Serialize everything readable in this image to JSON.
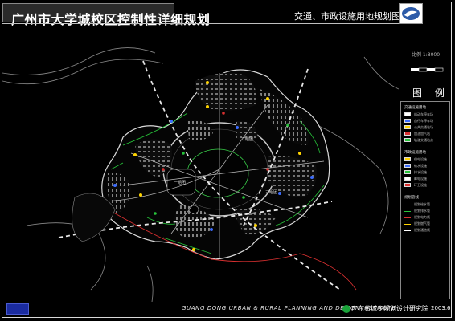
{
  "title": "广州市大学城校区控制性详细规划",
  "map_name": "交通、市政设施用地规划图",
  "scale": {
    "label": "比例 1:8000"
  },
  "legend": {
    "title": "图 例",
    "sections": [
      {
        "heading": "交通设施用地",
        "items": [
          "机动车停车场",
          "自行车停车场",
          "公共交通站场",
          "加油加气站",
          "轨道交通站点"
        ]
      },
      {
        "heading": "市政设施用地",
        "items": [
          "供电设施",
          "给水设施",
          "排水设施",
          "邮电设施",
          "环卫设施"
        ]
      },
      {
        "heading": "规划管线",
        "items": [
          "规划给水管",
          "规划排水管",
          "规划电力线",
          "规划燃气管",
          "规划通信线"
        ]
      }
    ]
  },
  "map_labels": {
    "district_1": "一组团",
    "district_2": "二组团",
    "district_3": "三组团"
  },
  "footer": {
    "institute_en": "GUANG DONG URBAN & RURAL PLANNING AND DESIGN INSTITUTE",
    "institute_cn": "广东省城乡规划设计研究院",
    "date": "2003.6"
  }
}
